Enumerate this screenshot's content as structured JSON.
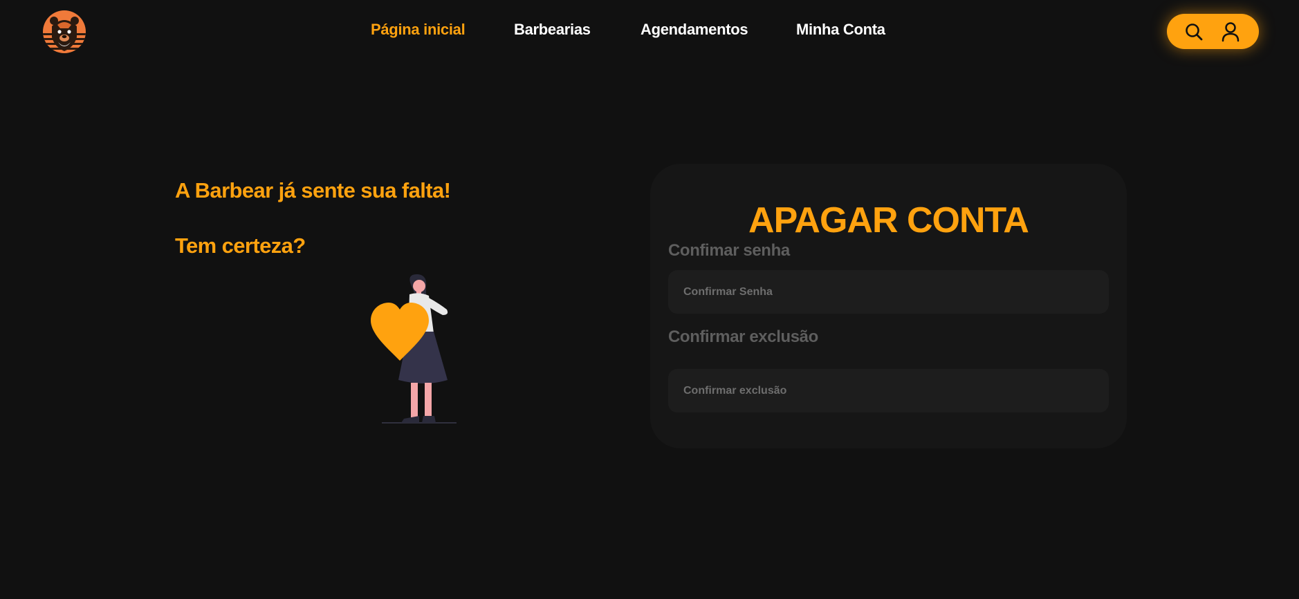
{
  "nav": {
    "links": [
      {
        "label": "Página inicial",
        "active": true
      },
      {
        "label": "Barbearias",
        "active": false
      },
      {
        "label": "Agendamentos",
        "active": false
      },
      {
        "label": "Minha Conta",
        "active": false
      }
    ],
    "icons": [
      "search-icon",
      "user-icon"
    ]
  },
  "hero": {
    "line1": "A Barbear já sente sua falta!",
    "line2": "Tem certeza?"
  },
  "form": {
    "title": "APAGAR CONTA",
    "password_label": "Confimar senha",
    "password_placeholder": "Confirmar Senha",
    "confirm_label": "Confirmar exclusão",
    "confirm_placeholder": "Confirmar exclusão"
  },
  "colors": {
    "accent": "#FFA20F",
    "background": "#111111",
    "card": "#161616",
    "input": "#1d1d1d",
    "label": "#5e5e5e"
  }
}
